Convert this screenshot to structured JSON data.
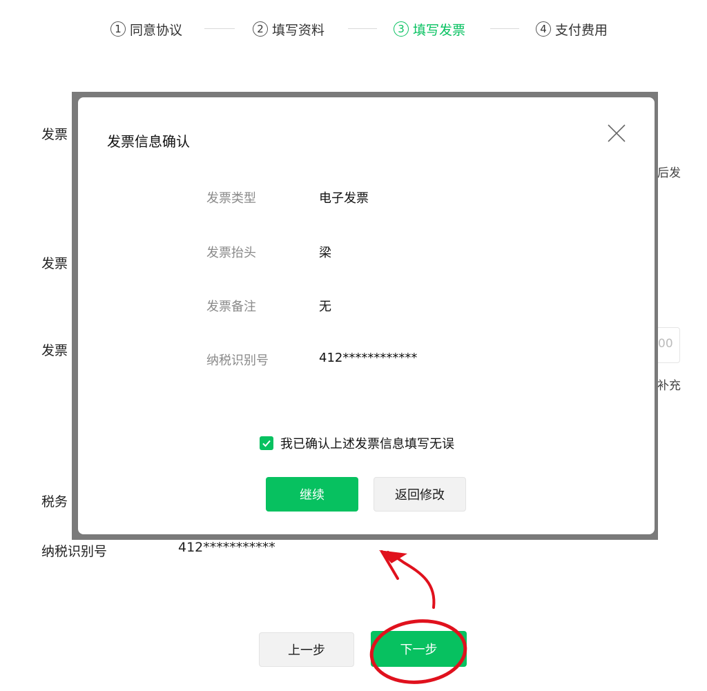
{
  "stepper": {
    "steps": [
      {
        "num": "1",
        "label": "同意协议"
      },
      {
        "num": "2",
        "label": "填写资料"
      },
      {
        "num": "3",
        "label": "填写发票"
      },
      {
        "num": "4",
        "label": "支付费用"
      }
    ],
    "active_step": 3
  },
  "background_form": {
    "left_label_1": "发票",
    "left_label_2": "发票",
    "left_label_3": "发票",
    "left_label_4": "税务",
    "right_fragment_1": "后发",
    "right_fragment_2": "补充",
    "input_fragment": "00",
    "taxid_label": "纳税识别号",
    "taxid_value": "412***********"
  },
  "footer": {
    "prev_label": "上一步",
    "next_label": "下一步"
  },
  "dialog": {
    "title": "发票信息确认",
    "rows": [
      {
        "label": "发票类型",
        "value": "电子发票"
      },
      {
        "label": "发票抬头",
        "value": "梁"
      },
      {
        "label": "发票备注",
        "value": "无"
      },
      {
        "label": "纳税识别号",
        "value": "412************"
      }
    ],
    "confirm_checkbox_label": "我已确认上述发票信息填写无误",
    "confirm_checked": true,
    "continue_label": "继续",
    "back_label": "返回修改"
  },
  "colors": {
    "accent": "#07c160",
    "annotation": "#e0111d",
    "overlay": "#7a7a7a"
  },
  "icons": [
    "close-icon",
    "check-icon"
  ]
}
